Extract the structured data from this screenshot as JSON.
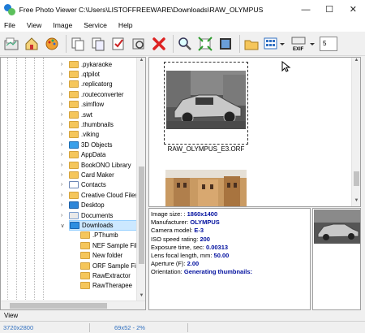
{
  "window": {
    "title": "Free Photo Viewer C:\\Users\\LISTOFFREEWARE\\Downloads\\RAW_OLYMPUS",
    "minimize": "—",
    "maximize": "☐",
    "close": "✕"
  },
  "menu": [
    "File",
    "View",
    "Image",
    "Service",
    "Help"
  ],
  "toolbar": {
    "exif_label": "EXIF",
    "page_value": "5"
  },
  "tree": [
    ".pykaraoke",
    ".qtpilot",
    ".replicatorg",
    ".routeconverter",
    ".simflow",
    ".swt",
    ".thumbnails",
    ".viking",
    "3D Objects",
    "AppData",
    "BookONO Library",
    "Card Maker",
    "Contacts",
    "Creative Cloud Files",
    "Desktop",
    "Documents",
    "Downloads",
    ".PThumb",
    "NEF Sample Files",
    "New folder",
    "ORF Sample Files",
    "RawExtractor",
    "RawTherapee"
  ],
  "thumbnails": [
    {
      "caption": "RAW_OLYMPUS_E3.ORF"
    }
  ],
  "info": [
    {
      "label": "Image size: :",
      "value": "1860x1400"
    },
    {
      "label": "Manufacturer:",
      "value": "OLYMPUS"
    },
    {
      "label": "Camera model:",
      "value": "E-3"
    },
    {
      "label": "ISO speed rating:",
      "value": "200"
    },
    {
      "label": "Exposure time, sec:",
      "value": "0.00313"
    },
    {
      "label": "Lens focal length, mm:",
      "value": "50.00"
    },
    {
      "label": "Aperture (F):",
      "value": "2.00"
    },
    {
      "label": "Orientation:",
      "value": "Generating thumbnails:"
    }
  ],
  "view_tab": "View",
  "status": {
    "dimensions": "3720x2800",
    "zoom": "69x52 - 2%"
  }
}
